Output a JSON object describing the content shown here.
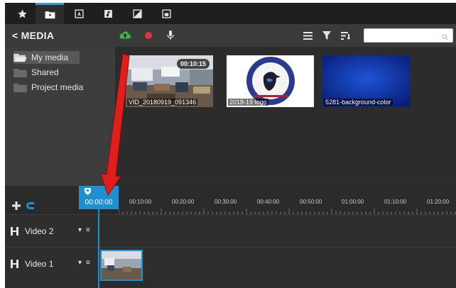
{
  "toolbar": {
    "buttons": [
      {
        "name": "favorites",
        "icon": "star-icon"
      },
      {
        "name": "media",
        "icon": "folder-icon",
        "active": true
      },
      {
        "name": "text",
        "icon": "text-icon"
      },
      {
        "name": "music",
        "icon": "music-icon"
      },
      {
        "name": "transitions",
        "icon": "transition-icon"
      },
      {
        "name": "overlays",
        "icon": "overlay-icon"
      }
    ]
  },
  "media_header": {
    "back_label": "< MEDIA",
    "upload_icon": "cloud-upload-icon",
    "record_icon": "record-icon",
    "mic_icon": "microphone-icon",
    "search_placeholder": ""
  },
  "folders": [
    {
      "label": "My media",
      "selected": true
    },
    {
      "label": "Shared",
      "selected": false
    },
    {
      "label": "Project media",
      "selected": false
    }
  ],
  "media_items": [
    {
      "label": "VID_20180919_091346",
      "duration": "00:10:15"
    },
    {
      "label": "2018-19 logo",
      "duration": ""
    },
    {
      "label": "5281-background-color",
      "duration": ""
    }
  ],
  "timeline": {
    "current_time": "00:00:00",
    "ticks": [
      "00:10:00",
      "00:20:00",
      "00:30:00",
      "00:40:00",
      "00:50:00",
      "01:00:00",
      "01:10:00",
      "01:20:00"
    ],
    "tracks": [
      {
        "label": "Video 2"
      },
      {
        "label": "Video 1"
      }
    ]
  },
  "colors": {
    "accent": "#1e8fd0",
    "record": "#e8323c",
    "upload": "#3bb54a",
    "annotation_arrow": "#e01e1e"
  }
}
